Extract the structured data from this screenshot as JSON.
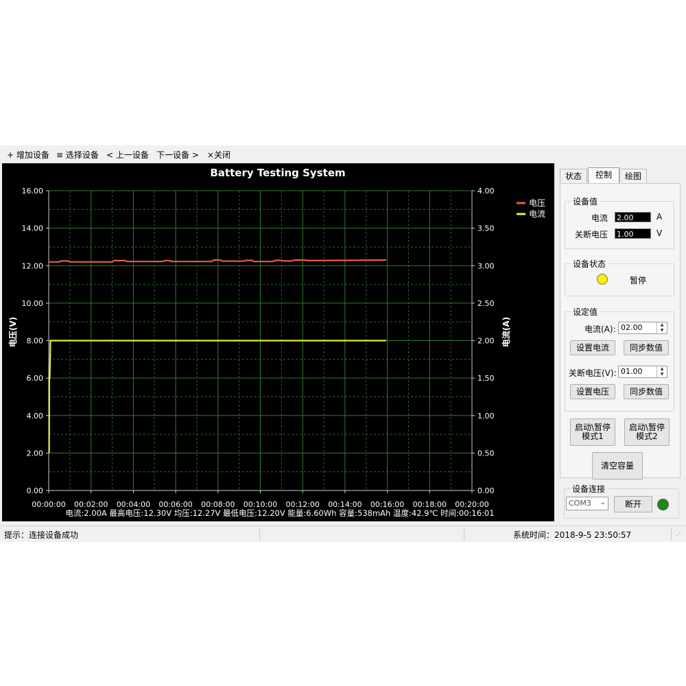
{
  "menu": {
    "add_device": "+ 增加设备",
    "select_device": "≡ 选择设备",
    "prev_device": "< 上一设备",
    "next_device": "下一设备 >",
    "close": "×关闭"
  },
  "chart_data": {
    "type": "line",
    "title": "Battery Testing System",
    "xlabel": "",
    "ylabel": "电压(V)",
    "y2label": "电流(A)",
    "x_ticks": [
      "00:00:00",
      "00:02:00",
      "00:04:00",
      "00:06:00",
      "00:08:00",
      "00:10:00",
      "00:12:00",
      "00:14:00",
      "00:16:00",
      "00:18:00",
      "00:20:00"
    ],
    "xlim_minutes": [
      0,
      20
    ],
    "ylim": [
      0,
      16
    ],
    "y_ticks": [
      "0.00",
      "2.00",
      "4.00",
      "6.00",
      "8.00",
      "10.00",
      "12.00",
      "14.00",
      "16.00"
    ],
    "y2lim": [
      0,
      4
    ],
    "y2_ticks": [
      "0.00",
      "0.50",
      "1.00",
      "1.50",
      "2.00",
      "2.50",
      "3.00",
      "3.50",
      "4.00"
    ],
    "grid": true,
    "legend_position": "top-right",
    "series": [
      {
        "name": "电压",
        "axis": "left",
        "color": "#e8603c",
        "x_minutes": [
          0,
          0.5,
          0.6,
          0.9,
          1.0,
          3.0,
          3.1,
          3.6,
          3.7,
          5.4,
          5.5,
          5.7,
          5.8,
          7.7,
          7.8,
          8.1,
          8.2,
          9.2,
          9.3,
          9.6,
          9.7,
          10.6,
          10.7,
          11.0,
          11.1,
          11.5,
          11.6,
          12.1,
          12.2,
          15.95
        ],
        "y": [
          12.2,
          12.2,
          12.25,
          12.25,
          12.2,
          12.2,
          12.27,
          12.27,
          12.22,
          12.22,
          12.27,
          12.27,
          12.22,
          12.22,
          12.3,
          12.3,
          12.24,
          12.24,
          12.28,
          12.28,
          12.22,
          12.22,
          12.28,
          12.28,
          12.25,
          12.25,
          12.3,
          12.3,
          12.27,
          12.3
        ]
      },
      {
        "name": "电流",
        "axis": "right",
        "color": "#e8f040",
        "x_minutes": [
          0.02,
          0.03,
          0.05,
          0.08,
          15.95
        ],
        "y": [
          0.5,
          1.5,
          1.5,
          2.0,
          2.0
        ]
      }
    ]
  },
  "stats_line": "电流:2.00A 最高电压:12.30V 均压:12.27V 最低电压:12.20V 能量:6.60Wh 容量:538mAh 温度:42.9℃ 时间:00:16:01",
  "tabs": [
    "状态",
    "控制",
    "绘图"
  ],
  "active_tab": "控制",
  "device_values": {
    "title": "设备值",
    "current_label": "电流",
    "current_value": "2.00",
    "current_unit": "A",
    "cutoff_label": "关断电压",
    "cutoff_value": "1.00",
    "cutoff_unit": "V"
  },
  "device_status": {
    "title": "设备状态",
    "state": "暂停",
    "indicator_color": "#ffee00"
  },
  "set_values": {
    "title": "设定值",
    "current_label": "电流(A):",
    "current_value": "02.00",
    "set_current_button": "设置电流",
    "sync_button_1": "同步数值",
    "cutoff_label": "关断电压(V):",
    "cutoff_value": "01.00",
    "set_voltage_button": "设置电压",
    "sync_button_2": "同步数值"
  },
  "mode_buttons": {
    "mode1_line1": "启动\\暂停",
    "mode1_line2": "模式1",
    "mode2_line1": "启动\\暂停",
    "mode2_line2": "模式2",
    "clear_capacity": "清空容量"
  },
  "connection": {
    "title": "设备连接",
    "port": "COM3",
    "disconnect_button": "断开",
    "indicator_color": "#1a8a1a"
  },
  "status_bar": {
    "message": "提示：连接设备成功",
    "system_time": "系统时间：2018-9-5 23:50:57"
  }
}
